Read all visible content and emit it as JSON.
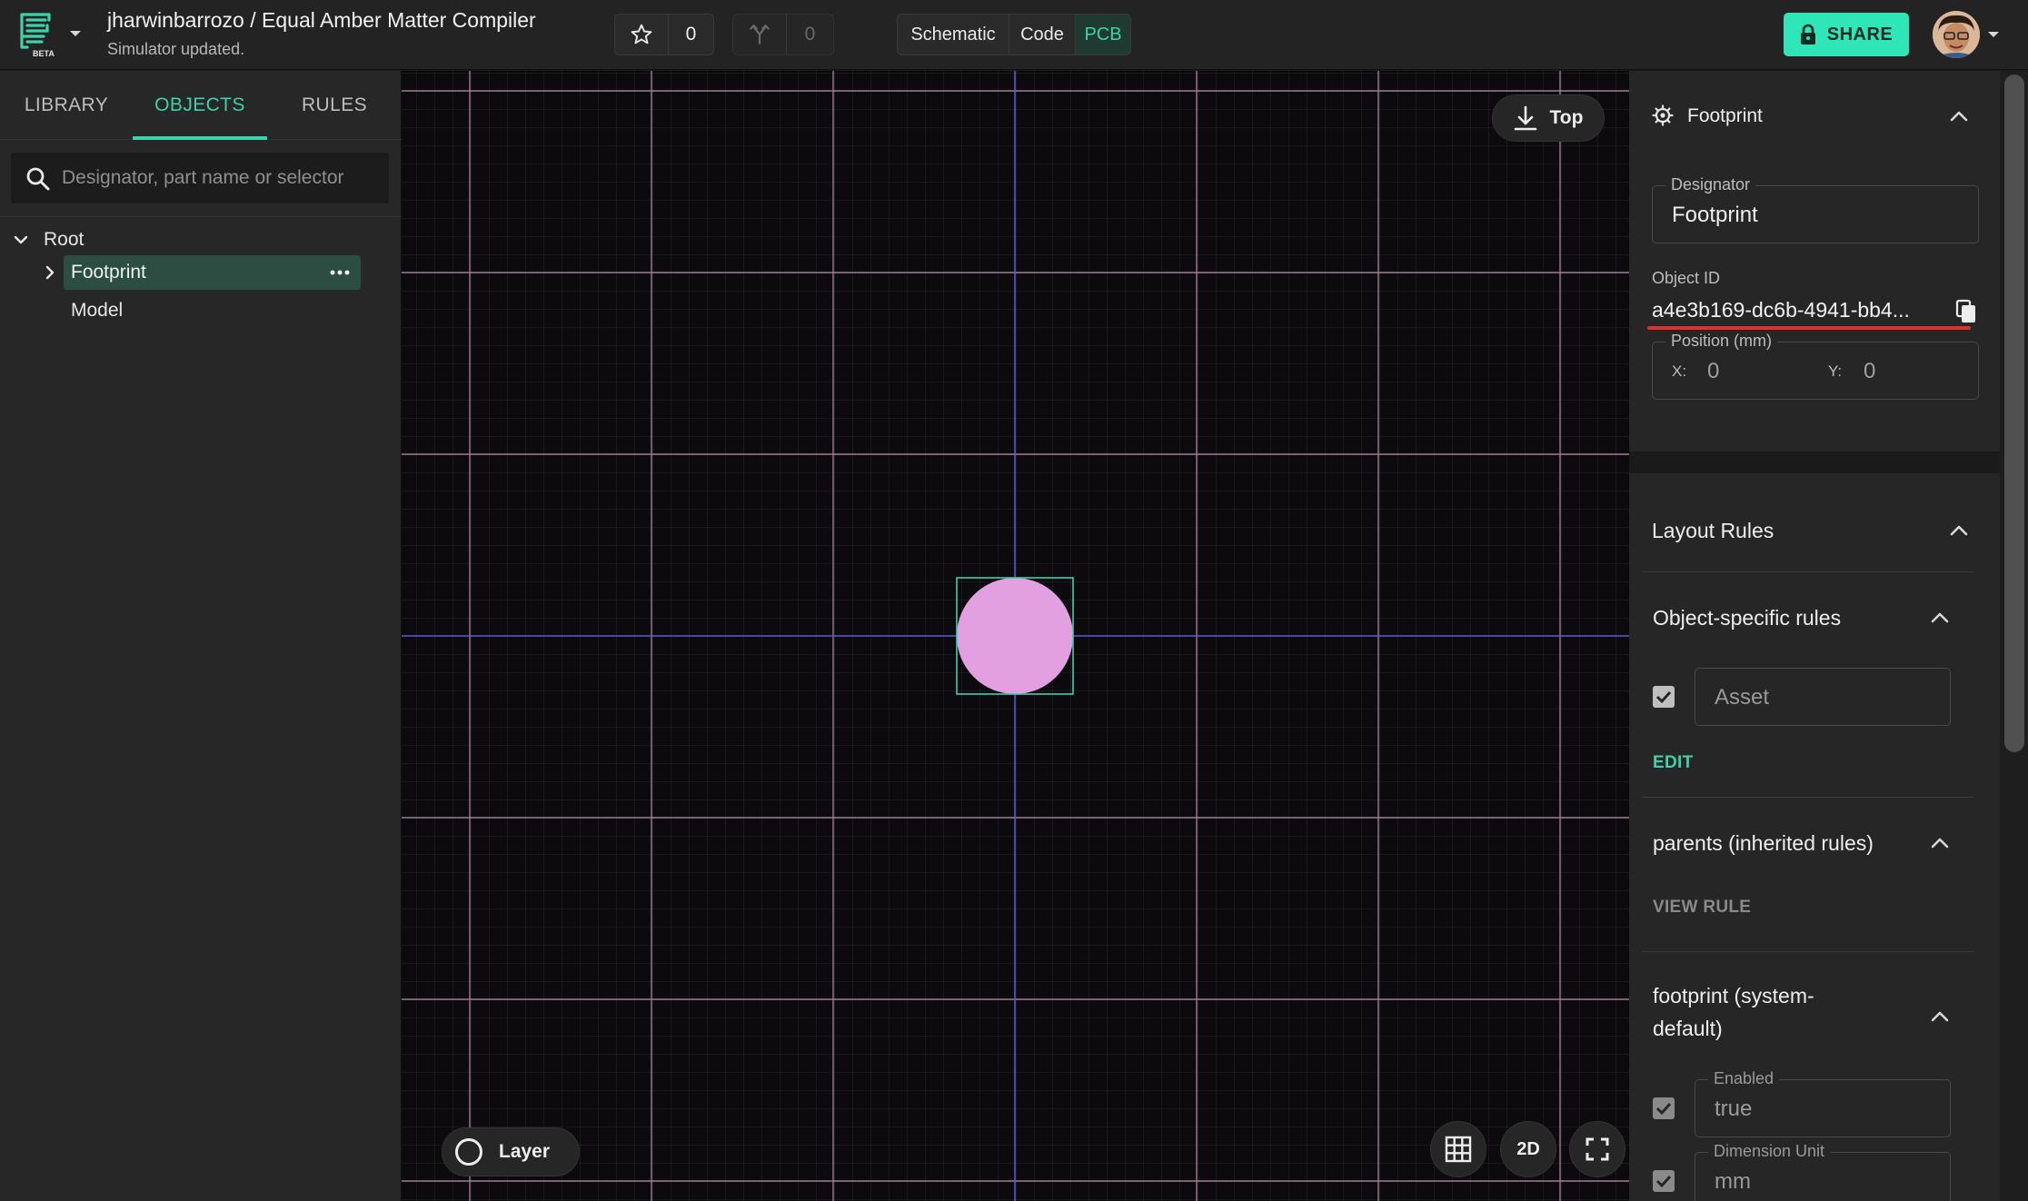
{
  "header": {
    "project_title": "jharwinbarrozo / Equal Amber Matter Compiler",
    "status": "Simulator updated.",
    "logo_badge": "BETA",
    "star_count": "0",
    "fork_count": "0",
    "views": {
      "schematic": "Schematic",
      "code": "Code",
      "pcb": "PCB",
      "active": "PCB"
    },
    "share_label": "SHARE",
    "accent_color": "#2ee6b8"
  },
  "left_panel": {
    "tabs": {
      "library": "LIBRARY",
      "objects": "OBJECTS",
      "rules": "RULES",
      "active": "OBJECTS"
    },
    "search": {
      "placeholder": "Designator, part name or selector",
      "value": ""
    },
    "tree": {
      "root": "Root",
      "items": [
        {
          "label": "Footprint",
          "selected": true
        },
        {
          "label": "Model",
          "selected": false
        }
      ]
    }
  },
  "canvas": {
    "view_label": "Top",
    "layer_label": "Layer",
    "mode_label": "2D",
    "footprint_fill_color": "#e3a0e0",
    "selection_color": "#3fd1a9"
  },
  "right_panel": {
    "footprint_card": {
      "title": "Footprint",
      "designator_label": "Designator",
      "designator_value": "Footprint",
      "object_id_label": "Object ID",
      "object_id_value": "a4e3b169-dc6b-4941-bb4...",
      "position_label": "Position (mm)",
      "x_label": "X:",
      "x_value": "0",
      "y_label": "Y:",
      "y_value": "0"
    },
    "layout_rules": {
      "title": "Layout Rules",
      "object_specific": {
        "title": "Object-specific rules",
        "asset_placeholder": "Asset",
        "asset_checked": true,
        "edit_label": "EDIT"
      },
      "parents": {
        "title": "parents (inherited rules)",
        "view_rule_label": "VIEW RULE"
      },
      "footprint_default": {
        "title_line1": "footprint (system-",
        "title_line2": "default)",
        "enabled_label": "Enabled",
        "enabled_value": "true",
        "dimension_unit_label": "Dimension Unit",
        "dimension_unit_value": "mm"
      }
    }
  }
}
